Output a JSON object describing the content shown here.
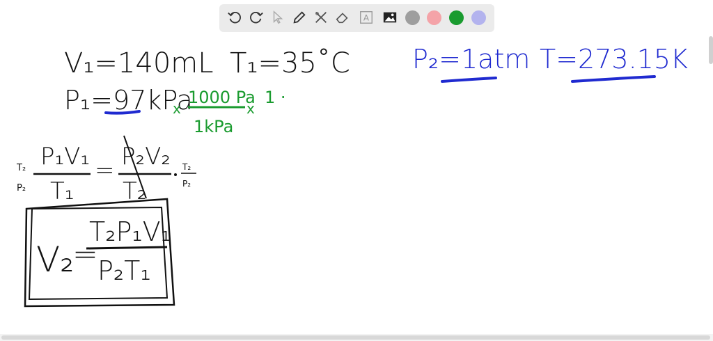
{
  "toolbar": {
    "tools": [
      "undo-icon",
      "redo-icon",
      "pointer-icon",
      "pen-icon",
      "tools-icon",
      "eraser-icon",
      "text-icon",
      "image-icon"
    ],
    "text_tool_glyph": "A",
    "colors": [
      "#9e9e9e",
      "#f4a3a8",
      "#1a9b2f",
      "#b3b3ee"
    ]
  },
  "board": {
    "v1": "V₁=140mL",
    "t1": "T₁=35˚C",
    "p1": "P₁=97kPa",
    "x1": "x",
    "conv_num": "1000 Pa",
    "conv_den": "1kPa",
    "x2": "x",
    "conv_tail": "1 ·",
    "p2": "P₂=1atm",
    "t": "T=273.15K",
    "eq_left_num": "P₁V₁",
    "eq_left_den": "T₁",
    "eq_equals": "=",
    "eq_right_num": "P₂V₂",
    "eq_right_den": "T₂",
    "eq_side_top": "T₂",
    "eq_side_bottom": "P₂",
    "eq_mult_top": "T₂",
    "eq_mult_bottom": "P₂",
    "boxed_lhs": "V₂",
    "boxed_equals": "=",
    "boxed_num": "T₂P₁V₁",
    "boxed_den": "P₂T₁"
  },
  "ink_colors": {
    "black": "#111111",
    "green": "#1a9b2f",
    "blue": "#1f2ad0"
  }
}
